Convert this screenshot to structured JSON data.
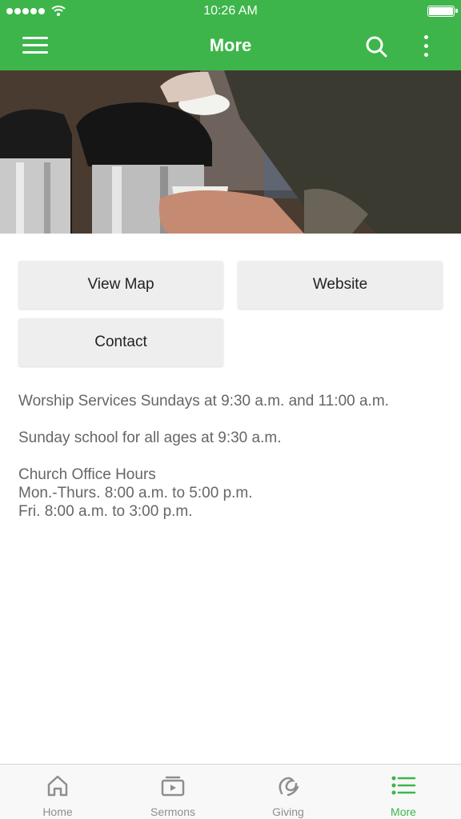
{
  "status_bar": {
    "time": "10:26 AM"
  },
  "nav": {
    "title": "More"
  },
  "hero": {
    "description": "coffee-dispensers-photo"
  },
  "buttons": {
    "view_map": "View Map",
    "website": "Website",
    "contact": "Contact"
  },
  "info": {
    "services": "Worship Services Sundays at 9:30 a.m. and 11:00 a.m.",
    "sunday_school": "Sunday school for all ages at 9:30 a.m.",
    "office_title": "Church Office Hours",
    "office_weekdays": "Mon.-Thurs. 8:00 a.m. to 5:00 p.m.",
    "office_friday": "Fri. 8:00 a.m. to 3:00 p.m."
  },
  "tabs": [
    {
      "label": "Home",
      "icon": "home-icon",
      "active": false
    },
    {
      "label": "Sermons",
      "icon": "sermons-icon",
      "active": false
    },
    {
      "label": "Giving",
      "icon": "giving-icon",
      "active": false
    },
    {
      "label": "More",
      "icon": "list-icon",
      "active": true
    }
  ],
  "colors": {
    "accent": "#3db54a",
    "tab_inactive": "#8e8e8e",
    "button_bg": "#eeeeef",
    "body_text": "#666666"
  }
}
